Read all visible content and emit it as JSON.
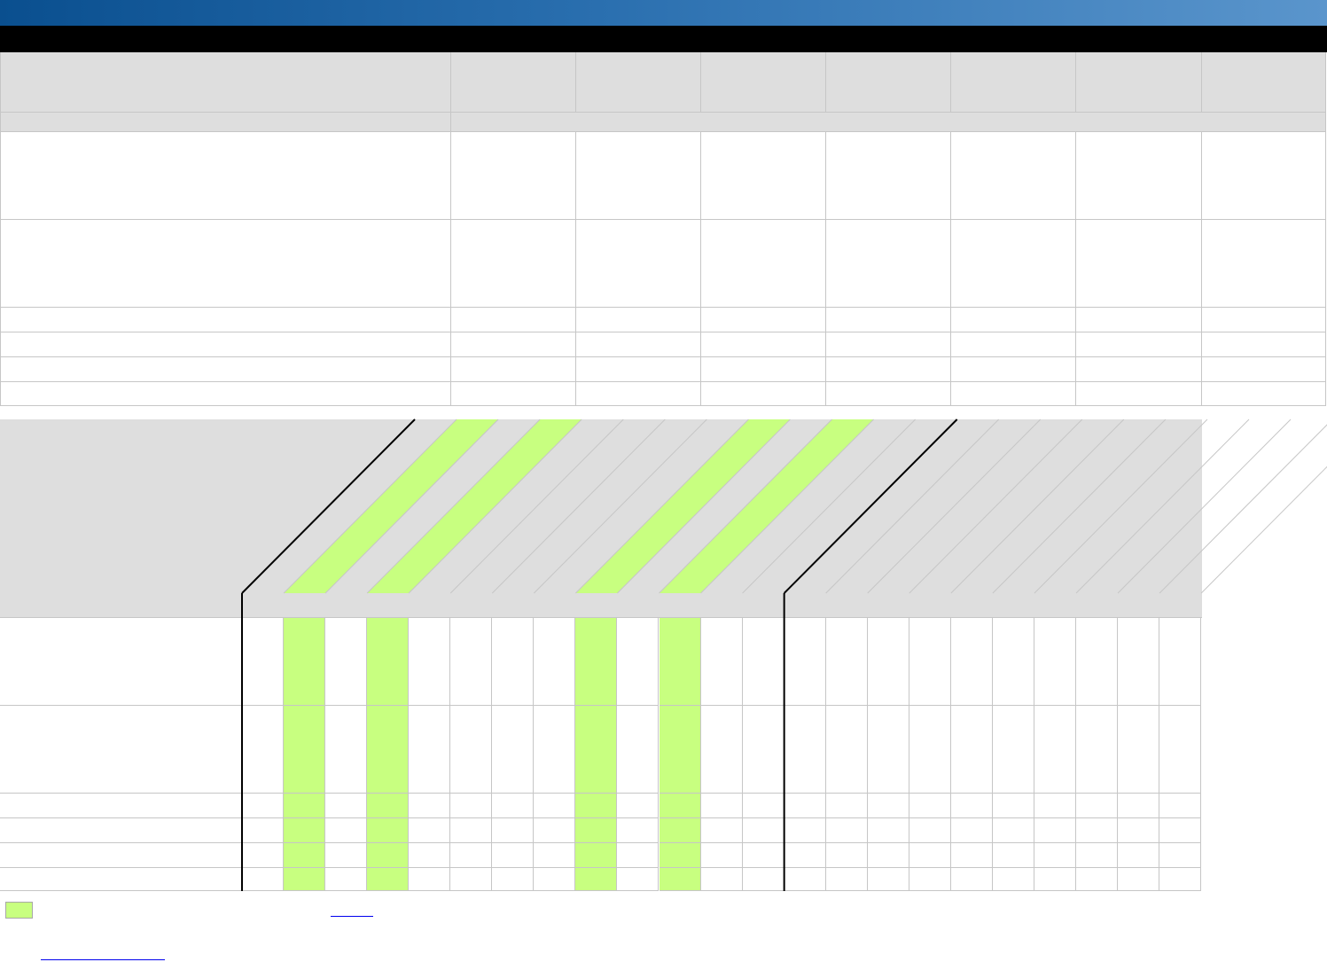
{
  "colors": {
    "highlight": "#c8ff80",
    "header_bg": "#dedede",
    "banner_start": "#0a4f8f",
    "banner_end": "#5a95cc",
    "grid_line": "#c6c6c6"
  },
  "top_table": {
    "column_count": 7,
    "row_count": 6,
    "header_text": [],
    "rows": []
  },
  "matrix": {
    "column_count": 23,
    "highlighted_columns": [
      1,
      3,
      8,
      10
    ],
    "separator_columns": [
      0,
      13
    ],
    "row_count": 6,
    "column_headers": [],
    "rows": []
  },
  "legend": {
    "label": "",
    "link_text": "",
    "footer_link_text": ""
  }
}
